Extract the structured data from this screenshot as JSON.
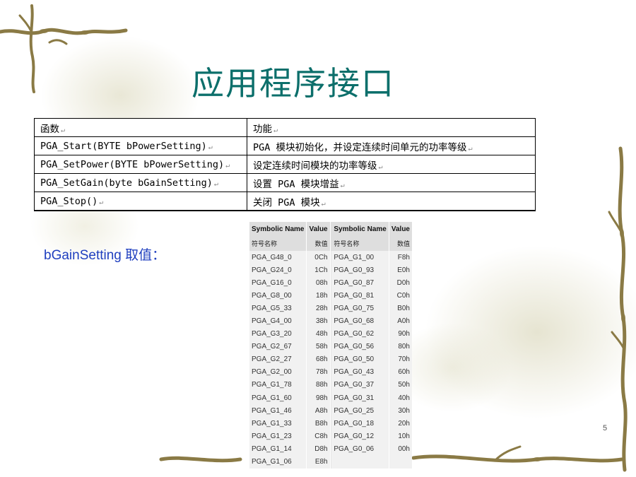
{
  "title": "应用程序接口",
  "api_table": {
    "rows": [
      {
        "func": "函数",
        "desc": "功能"
      },
      {
        "func": "PGA_Start(BYTE bPowerSetting)",
        "desc": "PGA 模块初始化，并设定连续时间单元的功率等级"
      },
      {
        "func": "PGA_SetPower(BYTE bPowerSetting)",
        "desc": "设定连续时间模块的功率等级"
      },
      {
        "func": "PGA_SetGain(byte bGainSetting)",
        "desc": "设置 PGA 模块增益"
      },
      {
        "func": "PGA_Stop()",
        "desc": "关闭 PGA 模块"
      }
    ],
    "return_mark": "↵"
  },
  "gain_label": "bGainSetting 取值：",
  "gain_table": {
    "headers": [
      "Symbolic Name",
      "Value",
      "Symbolic Name",
      "Value"
    ],
    "headers_cn": [
      "符号名称",
      "数值",
      "符号名称",
      "数值"
    ],
    "rows": [
      [
        "PGA_G48_0",
        "0Ch",
        "PGA_G1_00",
        "F8h"
      ],
      [
        "PGA_G24_0",
        "1Ch",
        "PGA_G0_93",
        "E0h"
      ],
      [
        "PGA_G16_0",
        "08h",
        "PGA_G0_87",
        "D0h"
      ],
      [
        "PGA_G8_00",
        "18h",
        "PGA_G0_81",
        "C0h"
      ],
      [
        "PGA_G5_33",
        "28h",
        "PGA_G0_75",
        "B0h"
      ],
      [
        "PGA_G4_00",
        "38h",
        "PGA_G0_68",
        "A0h"
      ],
      [
        "PGA_G3_20",
        "48h",
        "PGA_G0_62",
        "90h"
      ],
      [
        "PGA_G2_67",
        "58h",
        "PGA_G0_56",
        "80h"
      ],
      [
        "PGA_G2_27",
        "68h",
        "PGA_G0_50",
        "70h"
      ],
      [
        "PGA_G2_00",
        "78h",
        "PGA_G0_43",
        "60h"
      ],
      [
        "PGA_G1_78",
        "88h",
        "PGA_G0_37",
        "50h"
      ],
      [
        "PGA_G1_60",
        "98h",
        "PGA_G0_31",
        "40h"
      ],
      [
        "PGA_G1_46",
        "A8h",
        "PGA_G0_25",
        "30h"
      ],
      [
        "PGA_G1_33",
        "B8h",
        "PGA_G0_18",
        "20h"
      ],
      [
        "PGA_G1_23",
        "C8h",
        "PGA_G0_12",
        "10h"
      ],
      [
        "PGA_G1_14",
        "D8h",
        "PGA_G0_06",
        "00h"
      ],
      [
        "PGA_G1_06",
        "E8h",
        "",
        ""
      ]
    ]
  },
  "page_number": "5",
  "colors": {
    "title": "#0c6f6b",
    "label": "#1f3fbf",
    "vine": "#8a7a45"
  },
  "icons": [
    "vine-decoration",
    "flower-watermark"
  ]
}
